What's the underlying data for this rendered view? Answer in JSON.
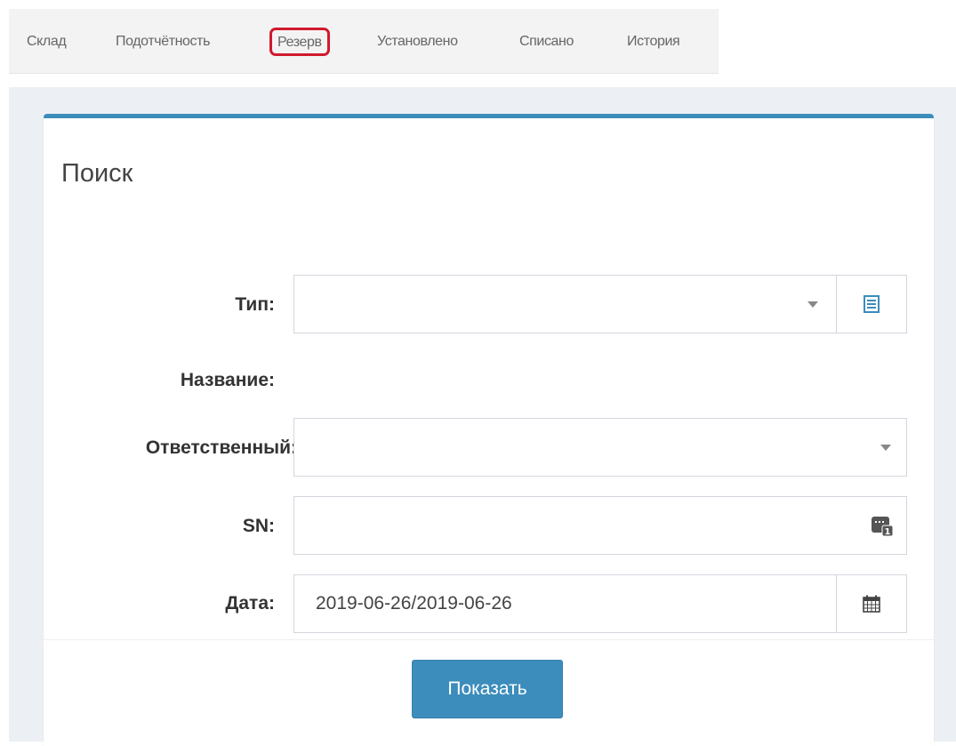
{
  "tabs": [
    {
      "label": "Склад"
    },
    {
      "label": "Подотчётность"
    },
    {
      "label": "Резерв",
      "active": true
    },
    {
      "label": "Установлено"
    },
    {
      "label": "Списано"
    },
    {
      "label": "История"
    }
  ],
  "search_box": {
    "title": "Поиск",
    "fields": {
      "type": {
        "label": "Тип:",
        "value": "",
        "addon_icon": "list-icon"
      },
      "name": {
        "label": "Название:"
      },
      "responsible": {
        "label": "Ответственный:",
        "value": ""
      },
      "sn": {
        "label": "SN:",
        "value": "",
        "addon_icon": "serial-number-icon"
      },
      "date": {
        "label": "Дата:",
        "value": "2019-06-26/2019-06-26",
        "addon_icon": "calendar-icon"
      }
    },
    "submit_label": "Показать"
  },
  "colors": {
    "accent": "#3c8dbc",
    "highlight": "#d1192d",
    "page_background": "#ecf0f5"
  }
}
